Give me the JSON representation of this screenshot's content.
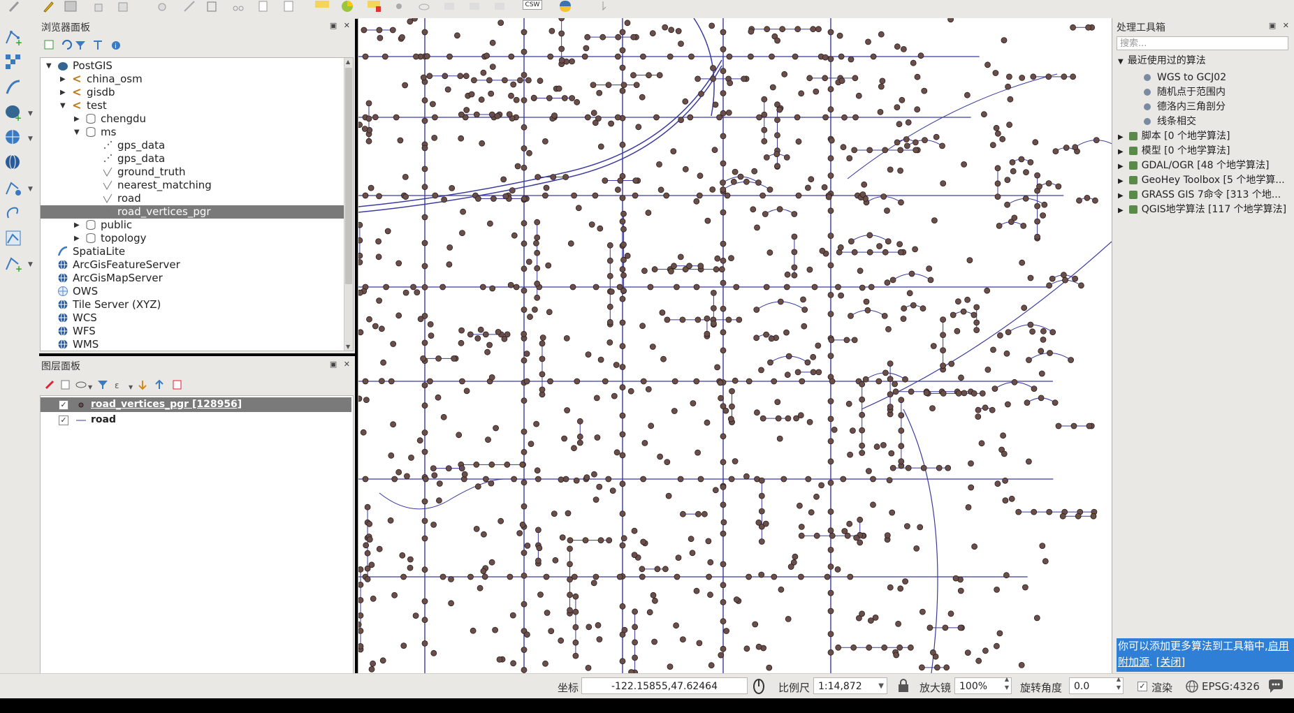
{
  "browser_panel": {
    "title": "浏览器面板",
    "tree": [
      {
        "label": "PostGIS",
        "level": 0,
        "expanded": true,
        "icon": "postgis-icon"
      },
      {
        "label": "china_osm",
        "level": 1,
        "expanded": false,
        "icon": "postgis-connection-icon"
      },
      {
        "label": "gisdb",
        "level": 1,
        "expanded": false,
        "icon": "postgis-connection-icon"
      },
      {
        "label": "test",
        "level": 1,
        "expanded": true,
        "icon": "postgis-connection-icon"
      },
      {
        "label": "chengdu",
        "level": 2,
        "expanded": false,
        "icon": "schema-icon"
      },
      {
        "label": "ms",
        "level": 2,
        "expanded": true,
        "icon": "schema-icon"
      },
      {
        "label": "gps_data",
        "level": 3,
        "icon": "point-layer-icon"
      },
      {
        "label": "gps_data",
        "level": 3,
        "icon": "point-layer-icon"
      },
      {
        "label": "ground_truth",
        "level": 3,
        "icon": "line-layer-icon"
      },
      {
        "label": "nearest_matching",
        "level": 3,
        "icon": "line-layer-icon"
      },
      {
        "label": "road",
        "level": 3,
        "icon": "line-layer-icon"
      },
      {
        "label": "road_vertices_pgr",
        "level": 3,
        "icon": "point-layer-icon",
        "selected": true
      },
      {
        "label": "public",
        "level": 2,
        "expanded": false,
        "icon": "schema-icon"
      },
      {
        "label": "topology",
        "level": 2,
        "expanded": false,
        "icon": "schema-icon"
      },
      {
        "label": "SpatiaLite",
        "level": 0,
        "icon": "spatialite-icon"
      },
      {
        "label": "ArcGisFeatureServer",
        "level": 0,
        "icon": "arcgis-globe-icon"
      },
      {
        "label": "ArcGisMapServer",
        "level": 0,
        "icon": "arcgis-globe-icon"
      },
      {
        "label": "OWS",
        "level": 0,
        "icon": "ows-icon"
      },
      {
        "label": "Tile Server (XYZ)",
        "level": 0,
        "icon": "xyz-globe-icon"
      },
      {
        "label": "WCS",
        "level": 0,
        "icon": "wcs-globe-icon"
      },
      {
        "label": "WFS",
        "level": 0,
        "icon": "wfs-globe-icon"
      },
      {
        "label": "WMS",
        "level": 0,
        "icon": "wms-globe-icon"
      }
    ]
  },
  "layers_panel": {
    "title": "图层面板",
    "layers": [
      {
        "label": "road_vertices_pgr [128956]",
        "checked": true,
        "symbol": "point",
        "selected": true
      },
      {
        "label": "road",
        "checked": true,
        "symbol": "line",
        "selected": false
      }
    ]
  },
  "toolbox": {
    "title": "处理工具箱",
    "search_placeholder": "搜索...",
    "recent_label": "最近使用过的算法",
    "recent": [
      "WGS to GCJ02",
      "随机点于范围内",
      "德洛内三角剖分",
      "线条相交"
    ],
    "groups": [
      "脚本 [0 个地学算法]",
      "模型 [0 个地学算法]",
      "GDAL/OGR [48 个地学算法]",
      "GeoHey Toolbox [5 个地学算...",
      "GRASS GIS 7命令 [313 个地...",
      "QGIS地学算法 [117 个地学算法]"
    ],
    "note_text": "你可以添加更多算法到工具箱中,",
    "note_link1": "启用",
    "note_link2": "附加源",
    "note_sep": ".",
    "note_close": "[关闭]"
  },
  "statusbar": {
    "coord_label": "坐标",
    "coord_value": "-122.15855,47.62464",
    "scale_label": "比例尺",
    "scale_value": "1:14,872",
    "magnifier_label": "放大镜",
    "magnifier_value": "100%",
    "rotation_label": "旋转角度",
    "rotation_value": "0.0",
    "render_label": "渲染",
    "render_checked": true,
    "crs": "EPSG:4326"
  },
  "toolbar": {
    "csw_label": "CSW"
  },
  "colors": {
    "road_line": "#3a3aa0",
    "vertex_fill": "#6a4e4a",
    "vertex_stroke": "#2a1e1e",
    "note_bg": "#2f7fd6",
    "selection": "#7a7a7a"
  }
}
